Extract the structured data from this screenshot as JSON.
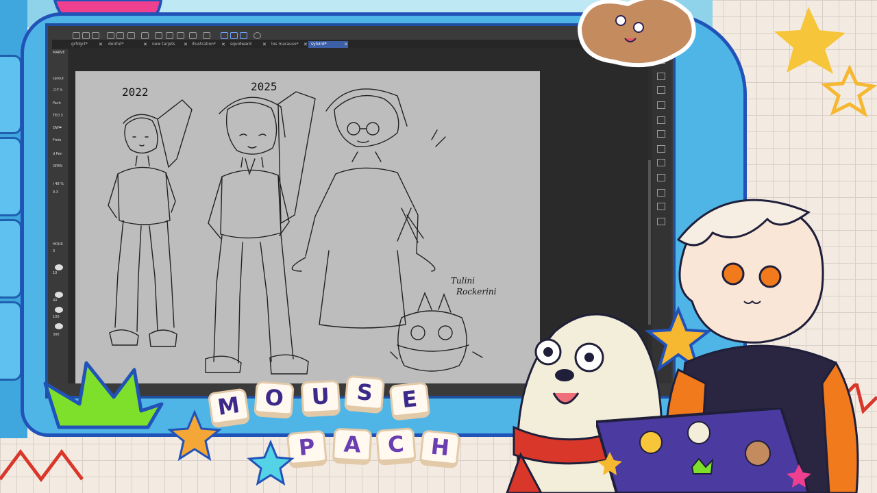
{
  "app": {
    "sidebar_title": "MARVE",
    "tabs": [
      {
        "label": "grfdgrt*",
        "active": false
      },
      {
        "label": "donfut*",
        "active": false
      },
      {
        "label": "new tarjets",
        "active": false
      },
      {
        "label": "illustration*",
        "active": false
      },
      {
        "label": "squidward",
        "active": false
      },
      {
        "label": "los marauso*",
        "active": false
      },
      {
        "label": "sylvird*",
        "active": true
      }
    ],
    "layers": [
      "sprout",
      "スケル",
      "Pach",
      "TED 3",
      "OW❤",
      "Fmia",
      "d Pen",
      "OPEN",
      "/ 48 %",
      "0.3"
    ],
    "brush_sizes": [
      "3",
      "10",
      "40",
      "100",
      "300"
    ],
    "brush_header": "HOUR"
  },
  "canvas": {
    "years": [
      "2022",
      "2025"
    ],
    "character_name_line1": "Tulini",
    "character_name_line2": "Rockerini"
  },
  "logo": {
    "row1": [
      "M",
      "O",
      "U",
      "S",
      "E"
    ],
    "row2": [
      "P",
      "A",
      "C",
      "H"
    ]
  },
  "colors": {
    "frame_blue": "#4fb5e6",
    "frame_border": "#2152b8",
    "crown_green": "#7ee02a",
    "star_yellow": "#f6b731",
    "scarf_red": "#d9372a",
    "hoodie_orange": "#f07a1c",
    "tablet_purple": "#4b3aa0"
  }
}
